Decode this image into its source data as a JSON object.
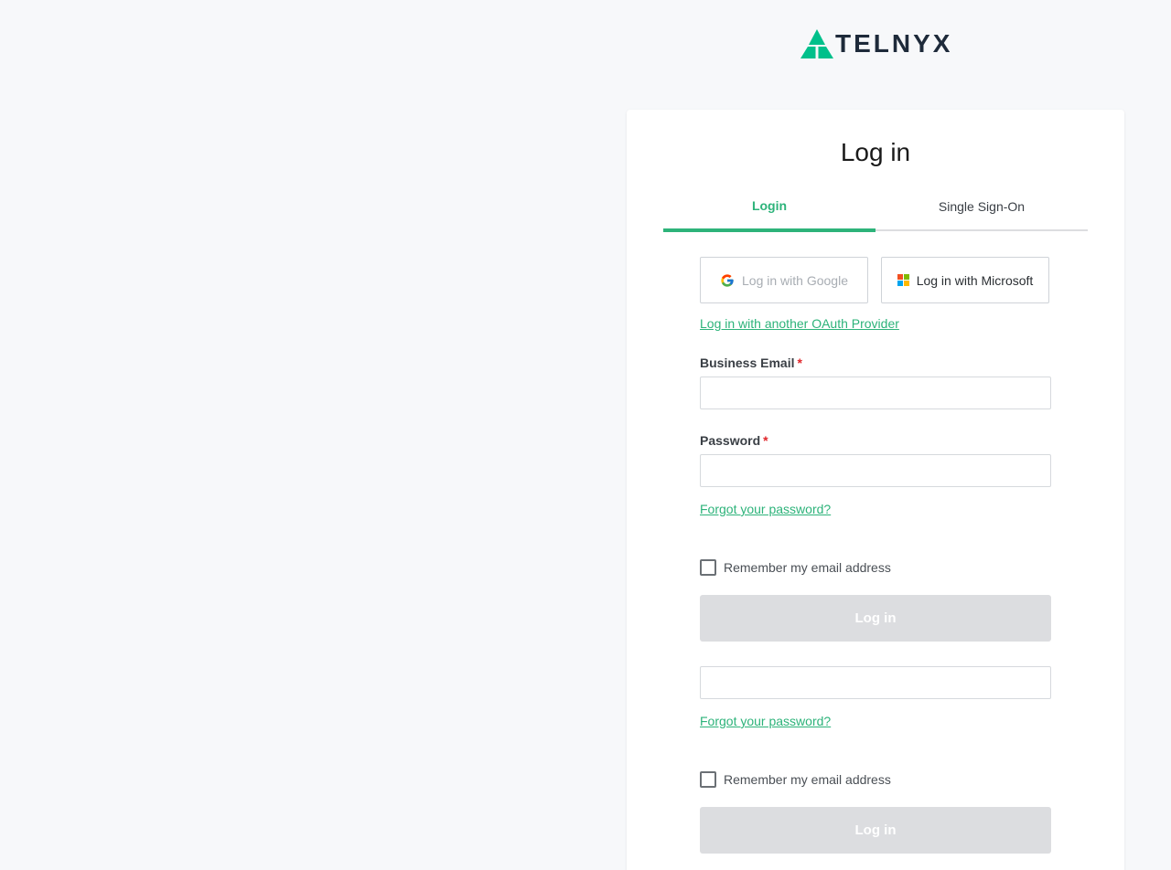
{
  "brand": {
    "name": "TELNYX",
    "logo_icon": "telnyx-triangle-logo",
    "color": "#1e2a3a",
    "accent": "#00c08b"
  },
  "card": {
    "title": "Log in"
  },
  "tabs": [
    {
      "label": "Login",
      "active": true
    },
    {
      "label": "Single Sign-On",
      "active": false
    }
  ],
  "oauth": {
    "google_label": "Log in with Google",
    "google_icon": "google-g-icon",
    "microsoft_label": "Log in with Microsoft",
    "microsoft_icon": "microsoft-logo-icon",
    "other_link": "Log in with another OAuth Provider"
  },
  "form": {
    "email_label": "Business Email",
    "email_value": "",
    "required_mark": "*",
    "password_label": "Password",
    "password_value": "",
    "forgot_link": "Forgot your password?",
    "remember_label": "Remember my email address",
    "remember_checked": false,
    "submit_label": "Log in"
  },
  "form_duplicate": {
    "input_value": "",
    "forgot_link": "Forgot your password?",
    "remember_label": "Remember my email address",
    "submit_label": "Log in"
  },
  "colors": {
    "accent_green": "#2db37a",
    "required_red": "#e0262b",
    "button_disabled": "#dcdde0",
    "page_background": "#f7f8fa"
  }
}
